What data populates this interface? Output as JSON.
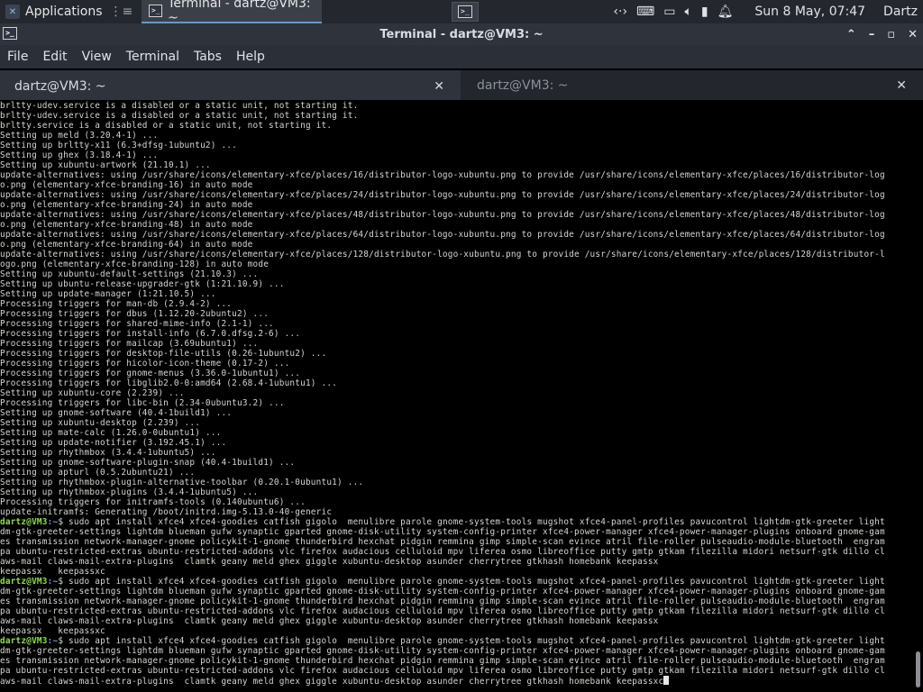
{
  "panel": {
    "applications": "Applications",
    "task_title": "Terminal - dartz@VM3: ~",
    "clock": "Sun  8 May, 07:47",
    "user": "Dartz"
  },
  "window": {
    "title": "Terminal - dartz@VM3: ~",
    "controls": {
      "minimize": "⌃",
      "maximize": "–",
      "restore": "▫",
      "close": "✕"
    }
  },
  "menu": [
    "File",
    "Edit",
    "View",
    "Terminal",
    "Tabs",
    "Help"
  ],
  "tabs": [
    {
      "label": "dartz@VM3: ~",
      "active": true
    },
    {
      "label": "dartz@VM3: ~",
      "active": false
    }
  ],
  "terminal": {
    "lines": [
      "brltty-udev.service is a disabled or a static unit, not starting it.",
      "brltty-udev.service is a disabled or a static unit, not starting it.",
      "brltty.service is a disabled or a static unit, not starting it.",
      "Setting up meld (3.20.4-1) ...",
      "Setting up brltty-x11 (6.3+dfsg-1ubuntu2) ...",
      "Setting up ghex (3.18.4-1) ...",
      "Setting up xubuntu-artwork (21.10.1) ...",
      "update-alternatives: using /usr/share/icons/elementary-xfce/places/16/distributor-logo-xubuntu.png to provide /usr/share/icons/elementary-xfce/places/16/distributor-log",
      "o.png (elementary-xfce-branding-16) in auto mode",
      "update-alternatives: using /usr/share/icons/elementary-xfce/places/24/distributor-logo-xubuntu.png to provide /usr/share/icons/elementary-xfce/places/24/distributor-log",
      "o.png (elementary-xfce-branding-24) in auto mode",
      "update-alternatives: using /usr/share/icons/elementary-xfce/places/48/distributor-logo-xubuntu.png to provide /usr/share/icons/elementary-xfce/places/48/distributor-log",
      "o.png (elementary-xfce-branding-48) in auto mode",
      "update-alternatives: using /usr/share/icons/elementary-xfce/places/64/distributor-logo-xubuntu.png to provide /usr/share/icons/elementary-xfce/places/64/distributor-log",
      "o.png (elementary-xfce-branding-64) in auto mode",
      "update-alternatives: using /usr/share/icons/elementary-xfce/places/128/distributor-logo-xubuntu.png to provide /usr/share/icons/elementary-xfce/places/128/distributor-l",
      "ogo.png (elementary-xfce-branding-128) in auto mode",
      "Setting up xubuntu-default-settings (21.10.3) ...",
      "Setting up ubuntu-release-upgrader-gtk (1:21.10.9) ...",
      "Setting up update-manager (1:21.10.5) ...",
      "Processing triggers for man-db (2.9.4-2) ...",
      "Processing triggers for dbus (1.12.20-2ubuntu2) ...",
      "Processing triggers for shared-mime-info (2.1-1) ...",
      "Processing triggers for install-info (6.7.0.dfsg.2-6) ...",
      "Processing triggers for mailcap (3.69ubuntu1) ...",
      "Processing triggers for desktop-file-utils (0.26-1ubuntu2) ...",
      "Processing triggers for hicolor-icon-theme (0.17-2) ...",
      "Processing triggers for gnome-menus (3.36.0-1ubuntu1) ...",
      "Processing triggers for libglib2.0-0:amd64 (2.68.4-1ubuntu1) ...",
      "Setting up xubuntu-core (2.239) ...",
      "Processing triggers for libc-bin (2.34-0ubuntu3.2) ...",
      "Setting up gnome-software (40.4-1build1) ...",
      "Setting up xubuntu-desktop (2.239) ...",
      "Setting up mate-calc (1.26.0-0ubuntu1) ...",
      "Setting up update-notifier (3.192.45.1) ...",
      "Setting up rhythmbox (3.4.4-1ubuntu5) ...",
      "Setting up gnome-software-plugin-snap (40.4-1build1) ...",
      "Setting up apturl (0.5.2ubuntu21) ...",
      "Setting up rhythmbox-plugin-alternative-toolbar (0.20.1-0ubuntu1) ...",
      "Setting up rhythmbox-plugins (3.4.4-1ubuntu5) ...",
      "Processing triggers for initramfs-tools (0.140ubuntu6) ...",
      "update-initramfs: Generating /boot/initrd.img-5.13.0-40-generic"
    ],
    "prompt_user": "dartz@VM3",
    "prompt_path": ":~",
    "prompt_symbol": "$",
    "commands": [
      {
        "first": " sudo apt install xfce4 xfce4-goodies catfish gigolo  menulibre parole gnome-system-tools mugshot xfce4-panel-profiles pavucontrol lightdm-gtk-greeter light",
        "cont": [
          "dm-gtk-greeter-settings lightdm blueman gufw synaptic gparted gnome-disk-utility system-config-printer xfce4-power-manager xfce4-power-manager-plugins onboard gnome-gam",
          "es transmission network-manager-gnome policykit-1-gnome thunderbird hexchat pidgin remmina gimp simple-scan evince atril file-roller pulseaudio-module-bluetooth  engram",
          "pa ubuntu-restricted-extras ubuntu-restricted-addons vlc firefox audacious celluloid mpv liferea osmo libreoffice putty gmtp gtkam filezilla midori netsurf-gtk dillo cl",
          "aws-mail claws-mail-extra-plugins  clamtk geany meld ghex giggle xubuntu-desktop asunder cherrytree gtkhash homebank keepassx",
          "keepassx   keepassxc"
        ]
      },
      {
        "first": " sudo apt install xfce4 xfce4-goodies catfish gigolo  menulibre parole gnome-system-tools mugshot xfce4-panel-profiles pavucontrol lightdm-gtk-greeter light",
        "cont": [
          "dm-gtk-greeter-settings lightdm blueman gufw synaptic gparted gnome-disk-utility system-config-printer xfce4-power-manager xfce4-power-manager-plugins onboard gnome-gam",
          "es transmission network-manager-gnome policykit-1-gnome thunderbird hexchat pidgin remmina gimp simple-scan evince atril file-roller pulseaudio-module-bluetooth  engram",
          "pa ubuntu-restricted-extras ubuntu-restricted-addons vlc firefox audacious celluloid mpv liferea osmo libreoffice putty gmtp gtkam filezilla midori netsurf-gtk dillo cl",
          "aws-mail claws-mail-extra-plugins  clamtk geany meld ghex giggle xubuntu-desktop asunder cherrytree gtkhash homebank keepassx",
          "keepassx   keepassxc"
        ]
      },
      {
        "first": " sudo apt install xfce4 xfce4-goodies catfish gigolo  menulibre parole gnome-system-tools mugshot xfce4-panel-profiles pavucontrol lightdm-gtk-greeter light",
        "cont": [
          "dm-gtk-greeter-settings lightdm blueman gufw synaptic gparted gnome-disk-utility system-config-printer xfce4-power-manager xfce4-power-manager-plugins onboard gnome-gam",
          "es transmission network-manager-gnome policykit-1-gnome thunderbird hexchat pidgin remmina gimp simple-scan evince atril file-roller pulseaudio-module-bluetooth  engram",
          "pa ubuntu-restricted-extras ubuntu-restricted-addons vlc firefox audacious celluloid mpv liferea osmo libreoffice putty gmtp gtkam filezilla midori netsurf-gtk dillo cl",
          "aws-mail claws-mail-extra-plugins  clamtk geany meld ghex giggle xubuntu-desktop asunder cherrytree gtkhash homebank keepassxc"
        ]
      }
    ]
  }
}
